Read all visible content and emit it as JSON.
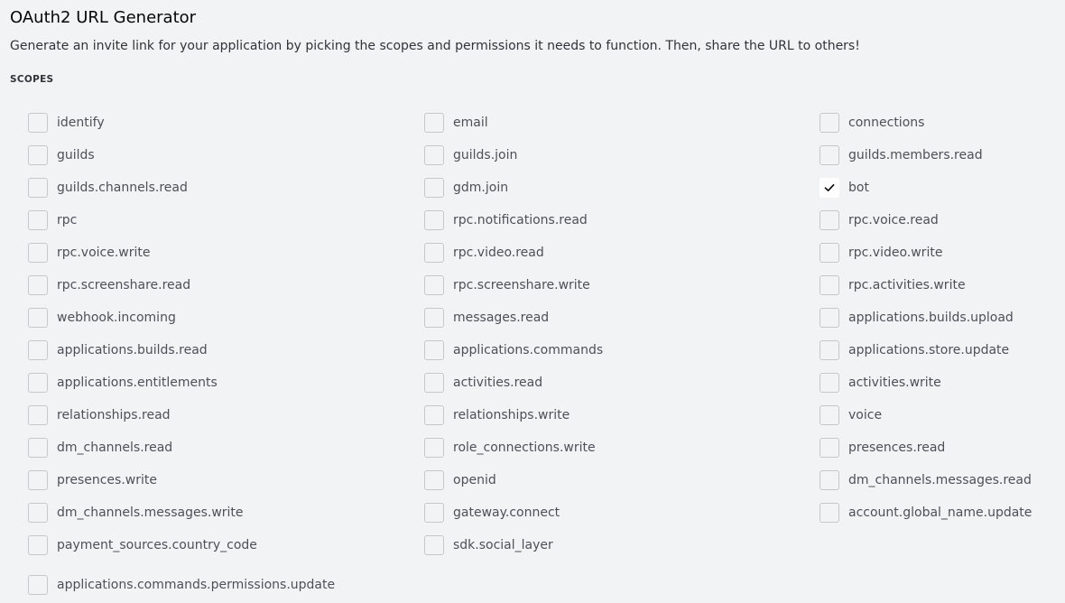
{
  "header": {
    "title": "OAuth2 URL Generator",
    "description": "Generate an invite link for your application by picking the scopes and permissions it needs to function. Then, share the URL to others!"
  },
  "scopes": {
    "section_label": "SCOPES",
    "items": [
      {
        "label": "identify",
        "checked": false
      },
      {
        "label": "email",
        "checked": false
      },
      {
        "label": "connections",
        "checked": false
      },
      {
        "label": "guilds",
        "checked": false
      },
      {
        "label": "guilds.join",
        "checked": false
      },
      {
        "label": "guilds.members.read",
        "checked": false
      },
      {
        "label": "guilds.channels.read",
        "checked": false
      },
      {
        "label": "gdm.join",
        "checked": false
      },
      {
        "label": "bot",
        "checked": true
      },
      {
        "label": "rpc",
        "checked": false
      },
      {
        "label": "rpc.notifications.read",
        "checked": false
      },
      {
        "label": "rpc.voice.read",
        "checked": false
      },
      {
        "label": "rpc.voice.write",
        "checked": false
      },
      {
        "label": "rpc.video.read",
        "checked": false
      },
      {
        "label": "rpc.video.write",
        "checked": false
      },
      {
        "label": "rpc.screenshare.read",
        "checked": false
      },
      {
        "label": "rpc.screenshare.write",
        "checked": false
      },
      {
        "label": "rpc.activities.write",
        "checked": false
      },
      {
        "label": "webhook.incoming",
        "checked": false
      },
      {
        "label": "messages.read",
        "checked": false
      },
      {
        "label": "applications.builds.upload",
        "checked": false
      },
      {
        "label": "applications.builds.read",
        "checked": false
      },
      {
        "label": "applications.commands",
        "checked": false
      },
      {
        "label": "applications.store.update",
        "checked": false
      },
      {
        "label": "applications.entitlements",
        "checked": false
      },
      {
        "label": "activities.read",
        "checked": false
      },
      {
        "label": "activities.write",
        "checked": false
      },
      {
        "label": "relationships.read",
        "checked": false
      },
      {
        "label": "relationships.write",
        "checked": false
      },
      {
        "label": "voice",
        "checked": false
      },
      {
        "label": "dm_channels.read",
        "checked": false
      },
      {
        "label": "role_connections.write",
        "checked": false
      },
      {
        "label": "presences.read",
        "checked": false
      },
      {
        "label": "presences.write",
        "checked": false
      },
      {
        "label": "openid",
        "checked": false
      },
      {
        "label": "dm_channels.messages.read",
        "checked": false
      },
      {
        "label": "dm_channels.messages.write",
        "checked": false
      },
      {
        "label": "gateway.connect",
        "checked": false
      },
      {
        "label": "account.global_name.update",
        "checked": false
      },
      {
        "label": "payment_sources.country_code",
        "checked": false
      },
      {
        "label": "sdk.social_layer",
        "checked": false
      },
      {
        "label": "applications.commands.permissions.update",
        "checked": false
      }
    ]
  }
}
